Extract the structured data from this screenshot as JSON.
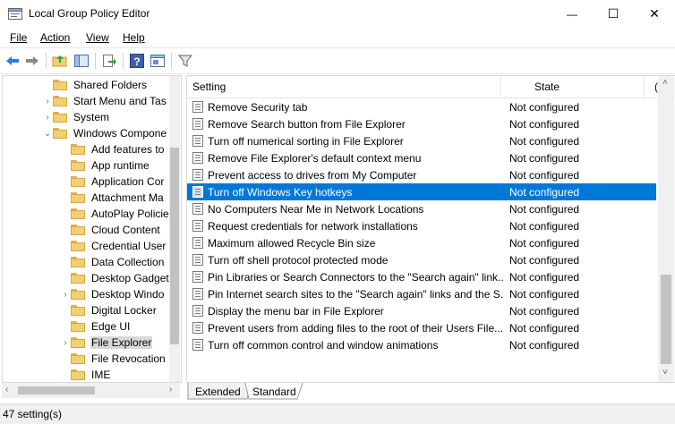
{
  "window": {
    "title": "Local Group Policy Editor",
    "minimize_glyph": "—",
    "maximize_glyph": "☐",
    "close_glyph": "✕"
  },
  "menu": [
    "File",
    "Action",
    "View",
    "Help"
  ],
  "tree": {
    "items": [
      {
        "label": "Shared Folders",
        "level": 1,
        "arrow": ""
      },
      {
        "label": "Start Menu and Tas",
        "level": 1,
        "arrow": "›"
      },
      {
        "label": "System",
        "level": 1,
        "arrow": "›"
      },
      {
        "label": "Windows Compone",
        "level": 1,
        "arrow": "⌄"
      },
      {
        "label": "Add features to",
        "level": 2,
        "arrow": ""
      },
      {
        "label": "App runtime",
        "level": 2,
        "arrow": ""
      },
      {
        "label": "Application Cor",
        "level": 2,
        "arrow": ""
      },
      {
        "label": "Attachment Ma",
        "level": 2,
        "arrow": ""
      },
      {
        "label": "AutoPlay Policie",
        "level": 2,
        "arrow": ""
      },
      {
        "label": "Cloud Content",
        "level": 2,
        "arrow": ""
      },
      {
        "label": "Credential User",
        "level": 2,
        "arrow": ""
      },
      {
        "label": "Data Collection",
        "level": 2,
        "arrow": ""
      },
      {
        "label": "Desktop Gadget",
        "level": 2,
        "arrow": ""
      },
      {
        "label": "Desktop Windo",
        "level": 2,
        "arrow": "›"
      },
      {
        "label": "Digital Locker",
        "level": 2,
        "arrow": ""
      },
      {
        "label": "Edge UI",
        "level": 2,
        "arrow": ""
      },
      {
        "label": "File Explorer",
        "level": 2,
        "arrow": "›",
        "selected": true
      },
      {
        "label": "File Revocation",
        "level": 2,
        "arrow": ""
      },
      {
        "label": "IME",
        "level": 2,
        "arrow": ""
      }
    ]
  },
  "list": {
    "columns": {
      "setting": "Setting",
      "state": "State",
      "extra": "("
    },
    "rows": [
      {
        "setting": "Remove Security tab",
        "state": "Not configured"
      },
      {
        "setting": "Remove Search button from File Explorer",
        "state": "Not configured"
      },
      {
        "setting": "Turn off numerical sorting in File Explorer",
        "state": "Not configured"
      },
      {
        "setting": "Remove File Explorer's default context menu",
        "state": "Not configured"
      },
      {
        "setting": "Prevent access to drives from My Computer",
        "state": "Not configured"
      },
      {
        "setting": "Turn off Windows Key hotkeys",
        "state": "Not configured",
        "selected": true
      },
      {
        "setting": "No Computers Near Me in Network Locations",
        "state": "Not configured"
      },
      {
        "setting": "Request credentials for network installations",
        "state": "Not configured"
      },
      {
        "setting": "Maximum allowed Recycle Bin size",
        "state": "Not configured"
      },
      {
        "setting": "Turn off shell protocol protected mode",
        "state": "Not configured"
      },
      {
        "setting": "Pin Libraries or Search Connectors to the \"Search again\" link...",
        "state": "Not configured"
      },
      {
        "setting": "Pin Internet search sites to the \"Search again\" links and the S...",
        "state": "Not configured"
      },
      {
        "setting": "Display the menu bar in File Explorer",
        "state": "Not configured"
      },
      {
        "setting": "Prevent users from adding files to the root of their Users File...",
        "state": "Not configured"
      },
      {
        "setting": "Turn off common control and window animations",
        "state": "Not configured"
      }
    ]
  },
  "tabs": [
    "Extended",
    "Standard"
  ],
  "status": "47 setting(s)",
  "colors": {
    "selection": "#0078d7",
    "accent_blue": "#1e64c8"
  }
}
